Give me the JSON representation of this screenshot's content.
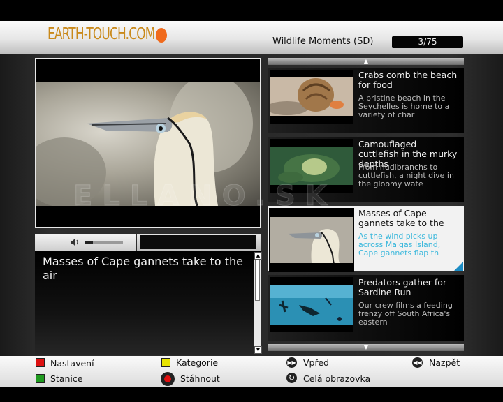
{
  "header": {
    "logo": "EARTH-TOUCH.COM",
    "channel": "Wildlife Moments (SD)",
    "counter": "3/75"
  },
  "player": {
    "description_title": "Masses of Cape gannets take to the air",
    "volume_level": 0.2,
    "scroll_up": "▲",
    "scroll_down": "▼"
  },
  "list": {
    "scroll_up": "▲",
    "scroll_down": "▼",
    "items": [
      {
        "title": "Crabs comb the beach for food",
        "desc": "A pristine beach in the Seychelles is home to a variety of char",
        "thumb": "crab-thumbnail"
      },
      {
        "title": "Camouflaged cuttlefish in the murky depths",
        "desc": "From nudibranchs to cuttlefish, a night dive in the gloomy wate",
        "thumb": "cuttlefish-thumbnail"
      },
      {
        "title": "Masses of Cape gannets take to the",
        "desc": "As the wind picks up across Malgas Island, Cape gannets flap th",
        "thumb": "gannet-thumbnail",
        "selected": true
      },
      {
        "title": "Predators gather for Sardine Run",
        "desc": "Our crew films a feeding frenzy off South Africa's eastern",
        "thumb": "diver-thumbnail"
      }
    ]
  },
  "watermark": "ELLANO.SK",
  "footer": {
    "red": "Nastavení",
    "green": "Stanice",
    "yellow": "Kategorie",
    "record": "Stáhnout",
    "forward": "Vpřed",
    "fullscreen": "Celá obrazovka",
    "back": "Nazpět",
    "colors": {
      "red": "#dd1111",
      "green": "#1f9a1f",
      "yellow": "#e8e400"
    }
  }
}
